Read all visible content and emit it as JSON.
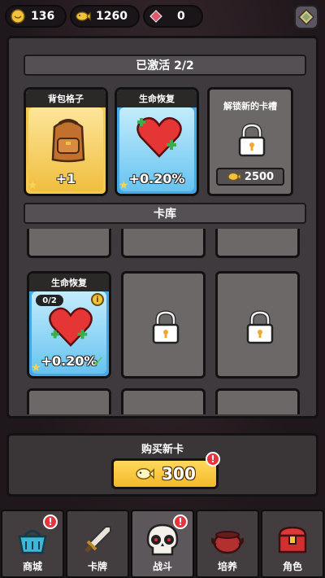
{
  "resources": {
    "coins": "136",
    "fish": "1260",
    "gems": "0"
  },
  "active_section": {
    "title": "已激活 2/2"
  },
  "active_cards": [
    {
      "title": "背包格子",
      "value": "+1"
    },
    {
      "title": "生命恢复",
      "value": "+0.20%"
    }
  ],
  "unlock_slot": {
    "title": "解锁新的卡槽",
    "price": "2500"
  },
  "library_section": {
    "title": "卡库"
  },
  "library_card": {
    "title": "生命恢复",
    "count": "0/2",
    "value": "+0.20%",
    "info": "i"
  },
  "buy": {
    "title": "购买新卡",
    "price": "300"
  },
  "nav": [
    {
      "label": "商城"
    },
    {
      "label": "卡牌"
    },
    {
      "label": "战斗"
    },
    {
      "label": "培养"
    },
    {
      "label": "角色"
    }
  ],
  "badge": "!",
  "colors": {
    "gold_card": "#f6c94e",
    "blue_card": "#48a8e6",
    "red_badge": "#e8333d"
  }
}
